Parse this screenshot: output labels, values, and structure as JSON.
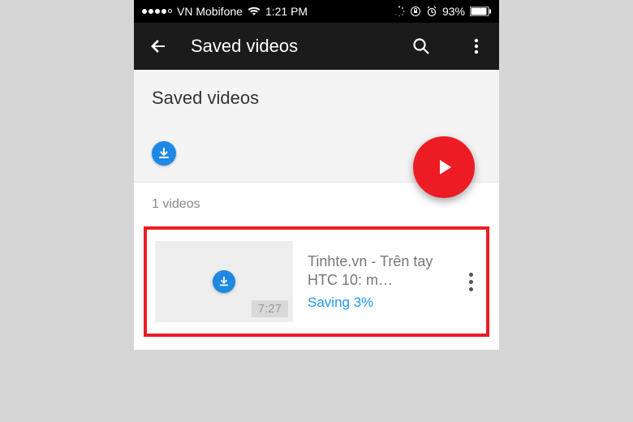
{
  "status": {
    "carrier": "VN Mobifone",
    "time": "1:21 PM",
    "battery_pct": "93%"
  },
  "appbar": {
    "title": "Saved videos"
  },
  "section": {
    "heading": "Saved videos",
    "count_label": "1 videos"
  },
  "video": {
    "title": "Tinhte.vn - Trên tay HTC 10: m…",
    "status": "Saving 3%",
    "duration": "7:27"
  }
}
